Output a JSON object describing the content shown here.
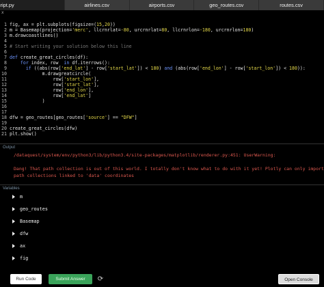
{
  "tabs": [
    "script.py",
    "airlines.csv",
    "airports.csv",
    "geo_routes.csv",
    "routes.csv"
  ],
  "close_glyph": "x",
  "code_lines": [
    {
      "n": "1",
      "html": "fig, ax = plt.subplots(figsize=(15,20))"
    },
    {
      "n": "2",
      "html": "m = Basemap(projection='merc', llcrnrlat=-80, urcrnrlat=80, llcrnrlon=-180, urcrnrlon=180)"
    },
    {
      "n": "3",
      "html": "m.drawcoastlines()"
    },
    {
      "n": "4",
      "html": ""
    },
    {
      "n": "5",
      "html": "# Start writing your solution below this line"
    },
    {
      "n": "6",
      "html": ""
    },
    {
      "n": "7",
      "html": "def create_great_circles(df):"
    },
    {
      "n": "8",
      "html": "    for index, row  in df.iterrows():"
    },
    {
      "n": "9",
      "html": "      if ((abs(row['end_lat'] - row['start_lat']) < 180) and (abs(row['end_lon'] - row['start_lon']) < 180)):"
    },
    {
      "n": "10",
      "html": "            m.drawgreatcircle("
    },
    {
      "n": "11",
      "html": "                row['start_lon'],"
    },
    {
      "n": "12",
      "html": "                row['start_lat'],"
    },
    {
      "n": "13",
      "html": "                row['end_lon'],"
    },
    {
      "n": "14",
      "html": "                row['end_lat']"
    },
    {
      "n": "15",
      "html": "            )"
    },
    {
      "n": "16",
      "html": ""
    },
    {
      "n": "17",
      "html": ""
    },
    {
      "n": "18",
      "html": "dfw = geo_routes[geo_routes['source'] == \"DFW\"]"
    },
    {
      "n": "19",
      "html": ""
    },
    {
      "n": "20",
      "html": "create_great_circles(dfw)"
    },
    {
      "n": "21",
      "html": "plt.show()"
    }
  ],
  "output": {
    "label": "Output",
    "lines": [
      "/dataquest/system/env/python3/lib/python3.4/site-packages/matplotlib/renderer.py:451: UserWarning:",
      "",
      "Dang! That path collection is out of this world. I totally don't know what to do with it yet! Plotly can only import",
      "path collections linked to 'data' coordinates"
    ]
  },
  "variables": {
    "label": "Variables",
    "items": [
      "m",
      "geo_routes",
      "Basemap",
      "dfw",
      "ax",
      "fig"
    ]
  },
  "buttons": {
    "run": "Run Code",
    "submit": "Submit Answer",
    "reset": "⟳",
    "console": "Open Console"
  }
}
